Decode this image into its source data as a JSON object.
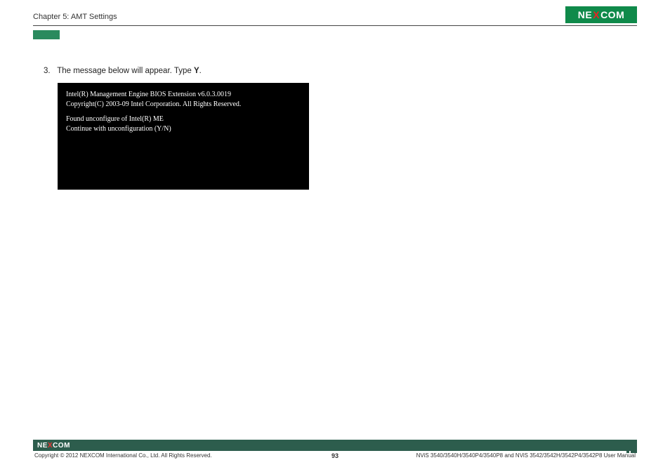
{
  "header": {
    "chapter": "Chapter 5: AMT Settings",
    "logo_text_1": "NE",
    "logo_text_x": "X",
    "logo_text_2": "COM"
  },
  "step": {
    "number": "3.",
    "text_before": "The message below will appear. Type ",
    "bold": "Y",
    "text_after": "."
  },
  "terminal": {
    "line1": "Intel(R) Management Engine BIOS Extension v6.0.3.0019",
    "line2": "Copyright(C) 2003-09 Intel Corporation. All Rights Reserved.",
    "line3": "Found unconfigure of Intel(R) ME",
    "line4": "Continue with unconfiguration (Y/N)"
  },
  "footer": {
    "logo_text_1": "NE",
    "logo_text_x": "X",
    "logo_text_2": "COM",
    "copyright": "Copyright © 2012 NEXCOM International Co., Ltd. All Rights Reserved.",
    "page": "93",
    "manual": "NViS 3540/3540H/3540P4/3540P8 and NViS 3542/3542H/3542P4/3542P8 User Manual"
  }
}
